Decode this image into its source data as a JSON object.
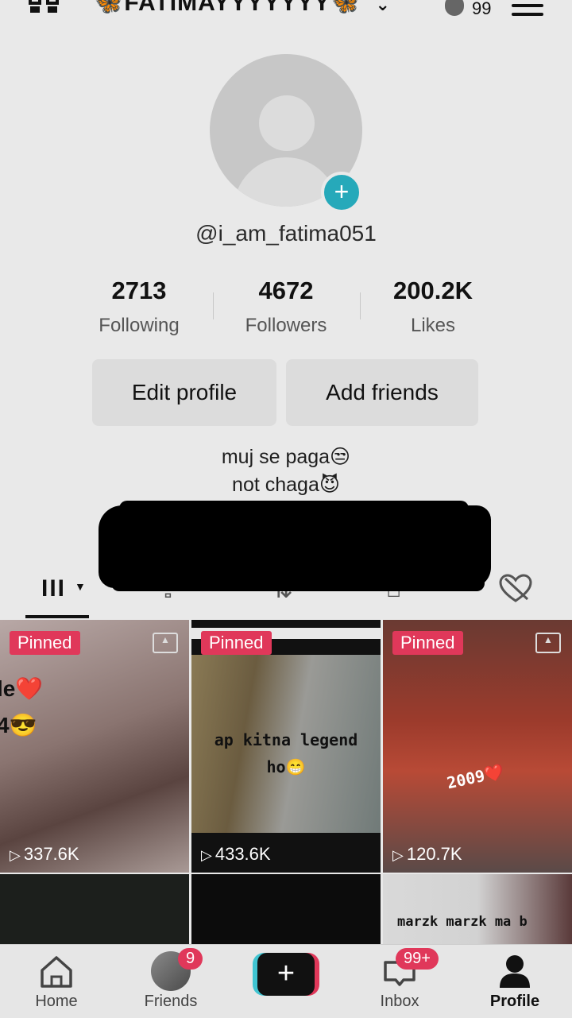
{
  "header": {
    "title": "🦋FATIMAYYYYYYY🦋",
    "chevron": "⌄",
    "mini_count": "99"
  },
  "profile": {
    "username": "@i_am_fatima051",
    "stats": [
      {
        "value": "2713",
        "label": "Following"
      },
      {
        "value": "4672",
        "label": "Followers"
      },
      {
        "value": "200.2K",
        "label": "Likes"
      }
    ],
    "edit_label": "Edit profile",
    "add_friends_label": "Add friends",
    "bio_line1": "muj se paga😒",
    "bio_line2": "not chaga😈"
  },
  "tabs": {
    "grid_icon": "III",
    "caret": "▼",
    "liked_icon": "liked-hidden-icon"
  },
  "videos": [
    {
      "pinned": "Pinned",
      "views": "337.6K",
      "caption": "le❤️\n4😎"
    },
    {
      "pinned": "Pinned",
      "views": "433.6K",
      "caption": "ap kitna legend\nho😁"
    },
    {
      "pinned": "Pinned",
      "views": "120.7K",
      "caption": "2009❤️"
    },
    {
      "caption": "marzk marzk ma b"
    }
  ],
  "nav": {
    "home": "Home",
    "friends": "Friends",
    "friends_badge": "9",
    "create": "+",
    "inbox": "Inbox",
    "inbox_badge": "99+",
    "profile": "Profile"
  },
  "colors": {
    "accent": "#e0385a",
    "teal": "#26a9ba"
  }
}
